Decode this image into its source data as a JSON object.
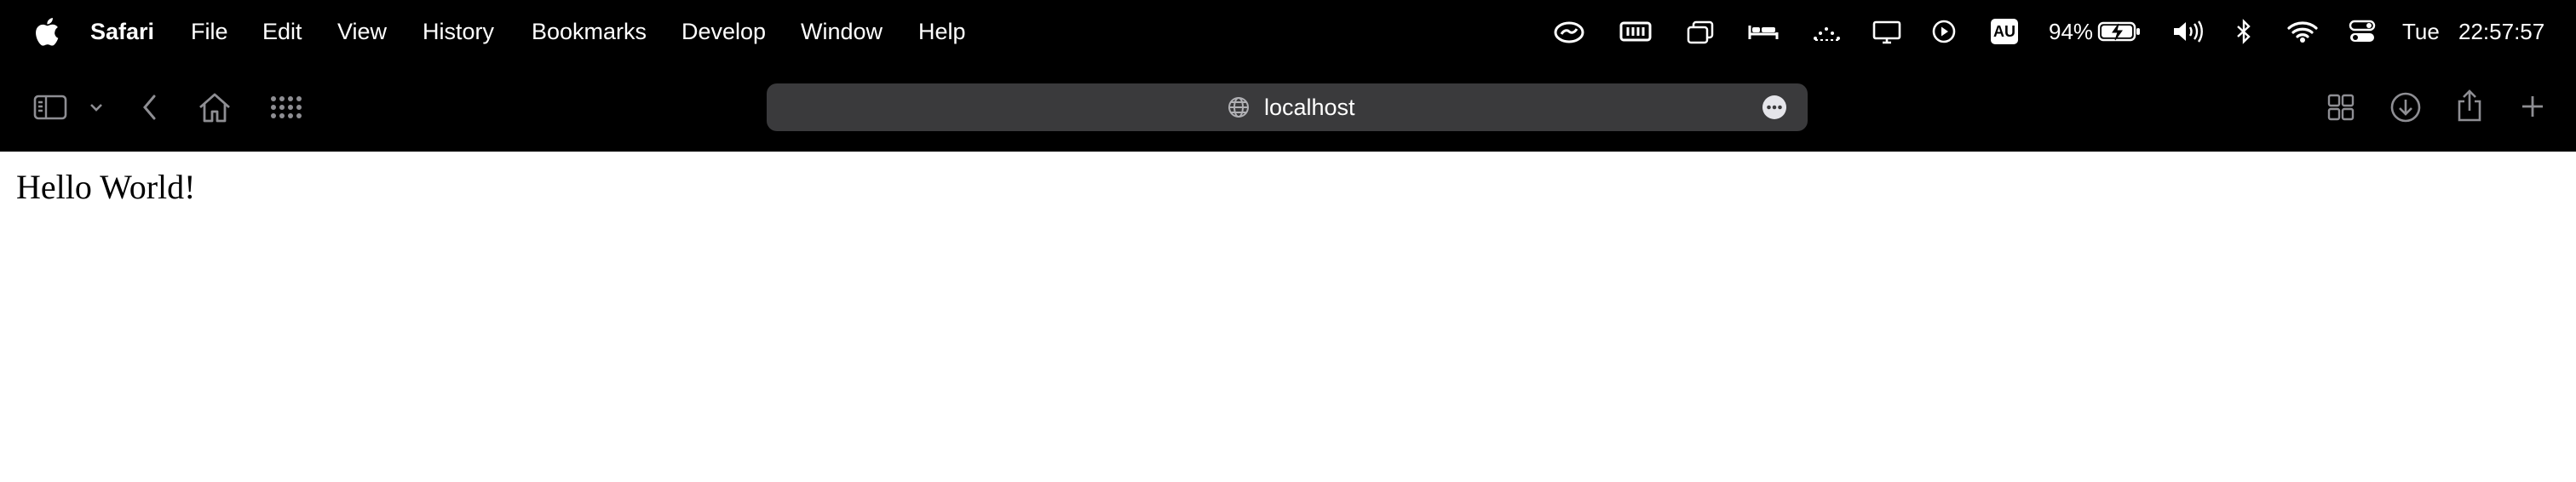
{
  "menubar": {
    "app_name": "Safari",
    "items": [
      "File",
      "Edit",
      "View",
      "History",
      "Bookmarks",
      "Develop",
      "Window",
      "Help"
    ],
    "status": {
      "battery_percent": "94%",
      "badge": "AU",
      "day": "Tue",
      "time": "22:57:57"
    }
  },
  "toolbar": {
    "address": "localhost"
  },
  "page": {
    "text": "Hello World!"
  }
}
